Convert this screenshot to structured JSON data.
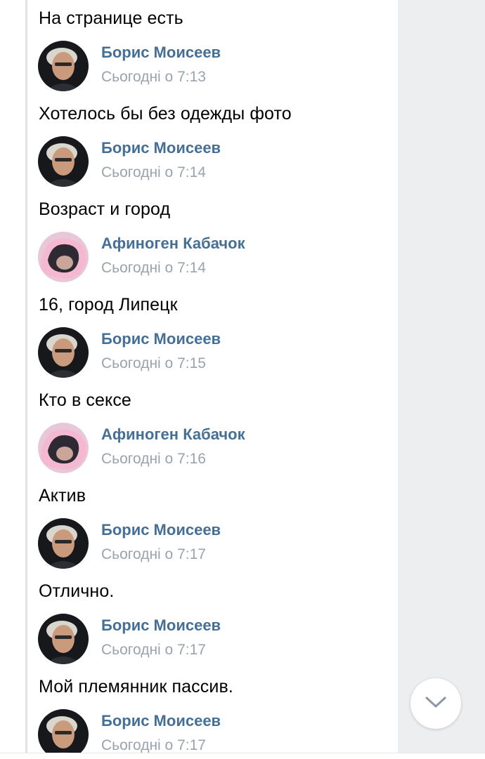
{
  "comments": [
    {
      "text": "На странице есть"
    },
    {
      "author": "Борис Моисеев",
      "time": "Сьогодні о 7:13",
      "avatar": "boris",
      "text": "Хотелось бы без одежды фото"
    },
    {
      "author": "Борис Моисеев",
      "time": "Сьогодні о 7:14",
      "avatar": "boris",
      "text": "Возраст и город"
    },
    {
      "author": "Афиноген Кабачок",
      "time": "Сьогодні о 7:14",
      "avatar": "afinogen",
      "text": "16, город Липецк"
    },
    {
      "author": "Борис Моисеев",
      "time": "Сьогодні о 7:15",
      "avatar": "boris",
      "text": "Кто в сексе"
    },
    {
      "author": "Афиноген Кабачок",
      "time": "Сьогодні о 7:16",
      "avatar": "afinogen",
      "text": "Актив"
    },
    {
      "author": "Борис Моисеев",
      "time": "Сьогодні о 7:17",
      "avatar": "boris",
      "text": "Отлично."
    },
    {
      "author": "Борис Моисеев",
      "time": "Сьогодні о 7:17",
      "avatar": "boris",
      "text": "Мой племянник пассив."
    },
    {
      "author": "Борис Моисеев",
      "time": "Сьогодні о 7:17",
      "avatar": "boris"
    }
  ],
  "scroll_button": {
    "icon": "chevron-down-icon"
  },
  "colors": {
    "author_name": "#466f96",
    "timestamp": "#9aa3ad",
    "side_panel": "#edeef0"
  }
}
